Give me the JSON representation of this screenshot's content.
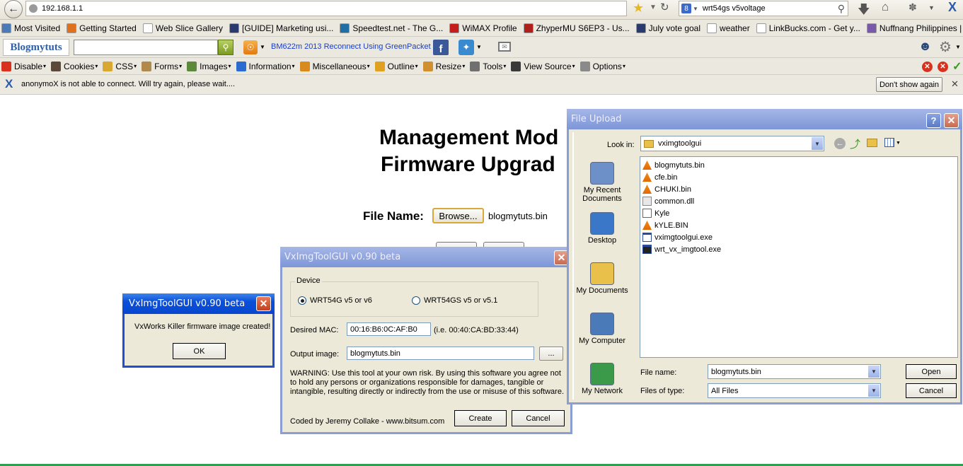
{
  "browser": {
    "url": "192.168.1.1",
    "search_engine_letter": "8",
    "search_value": "wrt54gs v5voltage",
    "x_mark": "X",
    "bookmarks": [
      {
        "label": "Most Visited",
        "icon_color": "#4a7ab8"
      },
      {
        "label": "Getting Started",
        "icon_color": "#e0701c"
      },
      {
        "label": "Web Slice Gallery",
        "icon_color": "#ffffff"
      },
      {
        "label": "[GUIDE] Marketing usi...",
        "icon_color": "#2b3a6e"
      },
      {
        "label": "Speedtest.net - The G...",
        "icon_color": "#1f6fa5"
      },
      {
        "label": "WiMAX Profile",
        "icon_color": "#c51c1c"
      },
      {
        "label": "ZhyperMU S6EP3 - Us...",
        "icon_color": "#b0201a"
      },
      {
        "label": "July vote goal",
        "icon_color": "#2b3a6e"
      },
      {
        "label": "weather",
        "icon_color": "#ffffff"
      },
      {
        "label": "LinkBucks.com - Get y...",
        "icon_color": "#ffffff"
      },
      {
        "label": "Nuffnang Philippines | ...",
        "icon_color": "#7a5aa8"
      }
    ],
    "toolbar_logo": "Blogmytuts",
    "toolbar_link": "BM622m 2013 Reconnect Using GreenPacket",
    "devtools": [
      {
        "label": "Disable",
        "icon_color": "#d8321e"
      },
      {
        "label": "Cookies",
        "icon_color": "#5b4a3a"
      },
      {
        "label": "CSS",
        "icon_color": "#d8a830"
      },
      {
        "label": "Forms",
        "icon_color": "#b08a4a"
      },
      {
        "label": "Images",
        "icon_color": "#5c8a3a"
      },
      {
        "label": "Information",
        "icon_color": "#2b6ad0"
      },
      {
        "label": "Miscellaneous",
        "icon_color": "#d88a1e"
      },
      {
        "label": "Outline",
        "icon_color": "#e0a020"
      },
      {
        "label": "Resize",
        "icon_color": "#d09030"
      },
      {
        "label": "Tools",
        "icon_color": "#707070"
      },
      {
        "label": "View Source",
        "icon_color": "#3a3a3a"
      },
      {
        "label": "Options",
        "icon_color": "#8a8a8a"
      }
    ],
    "notification": {
      "text": "anonymoX is not able to connect. Will try again, please wait....",
      "button": "Don't show again"
    }
  },
  "page": {
    "heading_line1": "Management Mod",
    "heading_line2": "Firmware Upgrad",
    "file_name_label": "File Name:",
    "browse_button": "Browse...",
    "file_value": "blogmytuts.bin"
  },
  "msgbox": {
    "title": "VxImgToolGUI v0.90 beta",
    "message": "VxWorks Killer firmware image created!",
    "ok": "OK"
  },
  "tool": {
    "title": "VxImgToolGUI v0.90 beta",
    "device_group": "Device",
    "radio1": "WRT54G v5 or v6",
    "radio2": "WRT54GS v5 or v5.1",
    "mac_label": "Desired MAC:",
    "mac_value": "00:16:B6:0C:AF:B0",
    "mac_hint": "(i.e. 00:40:CA:BD:33:44)",
    "output_label": "Output image:",
    "output_value": "blogmytuts.bin",
    "browse": "...",
    "warning": "WARNING: Use this tool at your own risk. By using this software you agree not to hold any persons or organizations responsible for damages, tangible or intangible, resulting directly or indirectly from the use or misuse of this software.",
    "credit": "Coded by Jeremy Collake - www.bitsum.com",
    "create": "Create",
    "cancel": "Cancel"
  },
  "upload": {
    "title": "File Upload",
    "help": "?",
    "look_in_label": "Look in:",
    "look_in_value": "vximgtoolgui",
    "places": [
      {
        "label": "My Recent Documents",
        "icon_color": "#6d90c8"
      },
      {
        "label": "Desktop",
        "icon_color": "#3b77c8"
      },
      {
        "label": "My Documents",
        "icon_color": "#e8c04a"
      },
      {
        "label": "My Computer",
        "icon_color": "#4a7ab8"
      },
      {
        "label": "My Network",
        "icon_color": "#3a9a4a"
      }
    ],
    "files": [
      {
        "name": "blogmytuts.bin",
        "icon": "vlc-cone-icon"
      },
      {
        "name": "cfe.bin",
        "icon": "vlc-cone-icon"
      },
      {
        "name": "CHUKI.bin",
        "icon": "vlc-cone-icon"
      },
      {
        "name": "common.dll",
        "icon": "dll-file-icon"
      },
      {
        "name": "Kyle",
        "icon": "generic-file-icon"
      },
      {
        "name": "kYLE.BIN",
        "icon": "vlc-cone-icon"
      },
      {
        "name": "vximgtoolgui.exe",
        "icon": "exe-window-icon"
      },
      {
        "name": "wrt_vx_imgtool.exe",
        "icon": "console-exe-icon"
      }
    ],
    "file_name_label": "File name:",
    "file_name_value": "blogmytuts.bin",
    "file_type_label": "Files of type:",
    "file_type_value": "All Files",
    "open": "Open",
    "cancel": "Cancel"
  }
}
